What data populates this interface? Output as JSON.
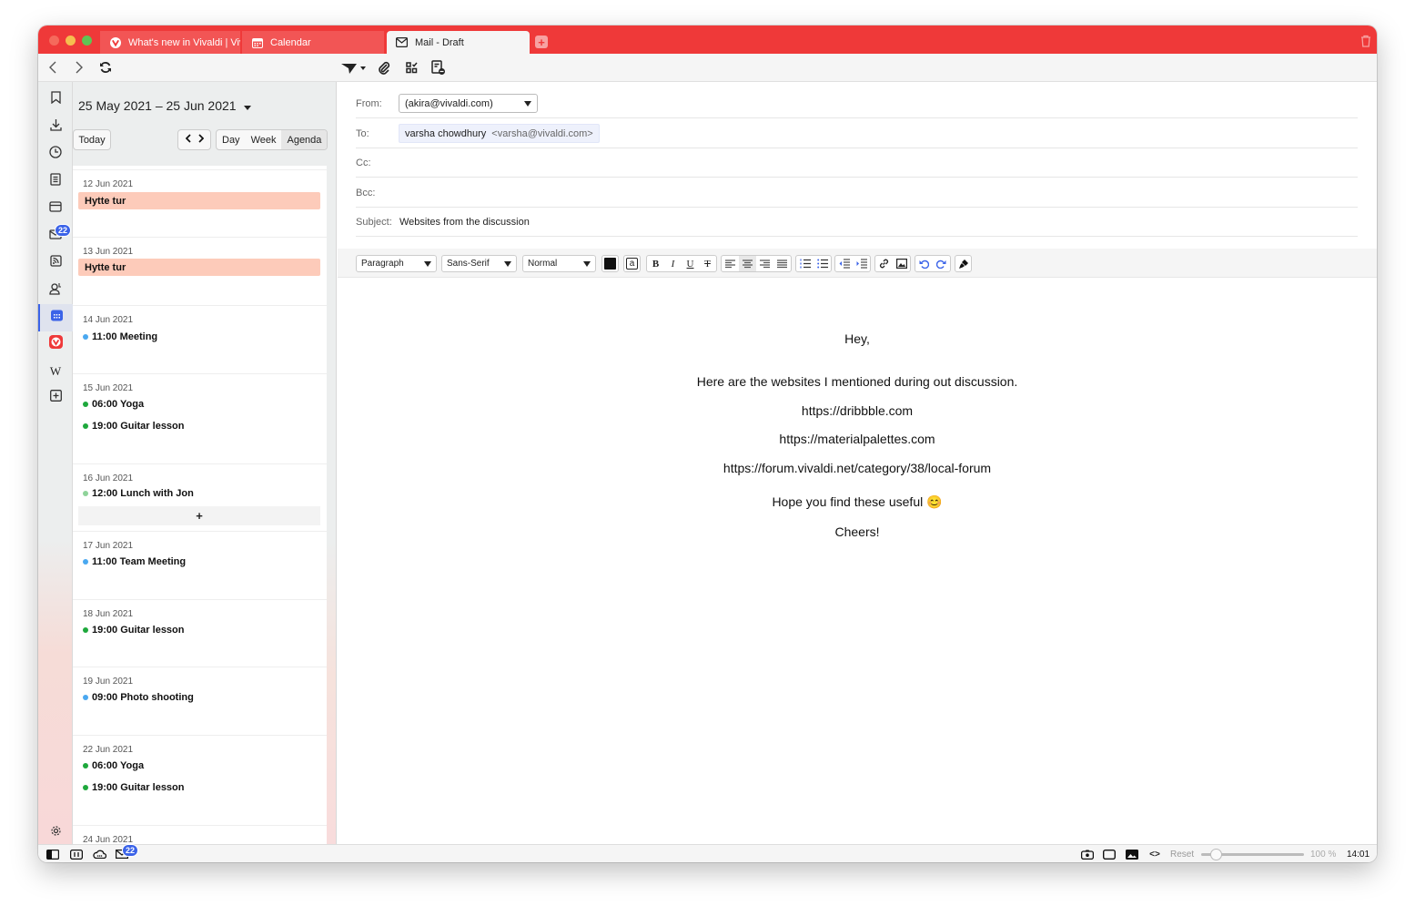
{
  "window": {
    "tabs": [
      {
        "label": "What's new in Vivaldi | Vivaldi",
        "icon": "vivaldi-icon"
      },
      {
        "label": "Calendar",
        "icon": "calendar-icon"
      },
      {
        "label": "Mail - Draft",
        "icon": "mail-icon",
        "active": true
      }
    ],
    "accent_color": "#ef3939"
  },
  "sidebar": {
    "items": [
      {
        "name": "bookmarks"
      },
      {
        "name": "downloads"
      },
      {
        "name": "history"
      },
      {
        "name": "notes"
      },
      {
        "name": "window-panel"
      },
      {
        "name": "mail",
        "badge": "22"
      },
      {
        "name": "feeds"
      },
      {
        "name": "contacts"
      },
      {
        "name": "calendar",
        "active": true
      },
      {
        "name": "vivaldi"
      },
      {
        "name": "wikipedia"
      },
      {
        "name": "add-panel"
      }
    ],
    "mail_badge": "22"
  },
  "calendar": {
    "range": "25 May 2021 – 25 Jun 2021",
    "today": "Today",
    "views": [
      "Day",
      "Week",
      "Agenda"
    ],
    "active_view": "Agenda",
    "add_label": "+",
    "days": [
      {
        "date": "12 Jun 2021",
        "allday": "Hytte tur"
      },
      {
        "date": "13 Jun 2021",
        "allday": "Hytte tur"
      },
      {
        "date": "14 Jun 2021",
        "events": [
          {
            "text": "11:00 Meeting",
            "color": "#4aa8f0"
          }
        ]
      },
      {
        "date": "15 Jun 2021",
        "events": [
          {
            "text": "06:00 Yoga",
            "color": "#1ea83c"
          },
          {
            "text": "19:00 Guitar lesson",
            "color": "#1ea83c"
          }
        ]
      },
      {
        "date": "16 Jun 2021",
        "events": [
          {
            "text": "12:00 Lunch with Jon",
            "color": "#8fd39a"
          }
        ]
      },
      {
        "date": "17 Jun 2021",
        "events": [
          {
            "text": "11:00 Team Meeting",
            "color": "#4aa8f0"
          }
        ]
      },
      {
        "date": "18 Jun 2021",
        "events": [
          {
            "text": "19:00 Guitar lesson",
            "color": "#1ea83c"
          }
        ]
      },
      {
        "date": "19 Jun 2021",
        "events": [
          {
            "text": "09:00 Photo shooting",
            "color": "#4aa8f0"
          }
        ]
      },
      {
        "date": "22 Jun 2021",
        "events": [
          {
            "text": "06:00 Yoga",
            "color": "#1ea83c"
          },
          {
            "text": "19:00 Guitar lesson",
            "color": "#1ea83c"
          }
        ]
      },
      {
        "date": "24 Jun 2021"
      }
    ]
  },
  "mail": {
    "from_label": "From:",
    "from_value": "(akira@vivaldi.com)",
    "to_label": "To:",
    "to_name": "varsha chowdhury",
    "to_email": "<varsha@vivaldi.com>",
    "cc_label": "Cc:",
    "bcc_label": "Bcc:",
    "subject_label": "Subject:",
    "subject_value": "Websites from the discussion",
    "format": {
      "block": "Paragraph",
      "font": "Sans-Serif",
      "size": "Normal"
    },
    "body": [
      "Hey,",
      "Here are the websites I mentioned during out discussion.",
      "https://dribbble.com",
      "https://materialpalettes.com",
      "https://forum.vivaldi.net/category/38/local-forum",
      "Hope you find these useful 😊",
      "Cheers!"
    ]
  },
  "statusbar": {
    "mail_badge": "22",
    "reset_label": "Reset",
    "zoom_level": "100 %",
    "zoom_fraction": 0.1,
    "clock": "14:01"
  }
}
